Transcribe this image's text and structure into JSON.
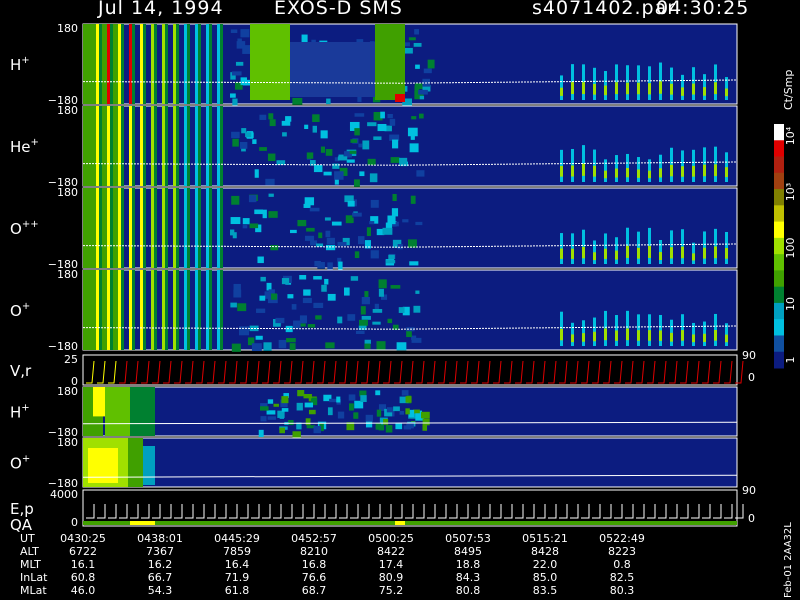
{
  "header": {
    "date": "Jul 14, 1994",
    "instrument": "EXOS-D SMS",
    "file": "s4071402.par",
    "time": "04:30:25"
  },
  "colorbar": {
    "unit": "Ct/Smp",
    "ticks": [
      "10⁴",
      "10³",
      "100",
      "10",
      "1"
    ],
    "colors": [
      "#ffffff",
      "#e00000",
      "#b02010",
      "#a04010",
      "#808000",
      "#c0c000",
      "#ffff00",
      "#a0e000",
      "#60c000",
      "#40a000",
      "#008030",
      "#00a0c0",
      "#00c0e0",
      "#1050a0",
      "#0c1c80"
    ]
  },
  "chart_data": {
    "type": "heatmap",
    "x_time_ticks": [
      "0430:25",
      "0438:01",
      "0445:29",
      "0452:57",
      "0500:25",
      "0507:53",
      "0515:21",
      "0522:49"
    ],
    "panels": [
      {
        "label": "H",
        "sup": "+",
        "y_top": "180",
        "y_bottom": "−180"
      },
      {
        "label": "He",
        "sup": "+",
        "y_top": "180",
        "y_bottom": "−180"
      },
      {
        "label": "O",
        "sup": "++",
        "y_top": "180",
        "y_bottom": "−180"
      },
      {
        "label": "O",
        "sup": "+",
        "y_top": "180",
        "y_bottom": "−180"
      },
      {
        "label": "V,r",
        "sup": "",
        "y_top": "25",
        "y_bottom": "0",
        "right_top": "90",
        "right_bottom": "0"
      },
      {
        "label": "H",
        "sup": "+",
        "y_top": "180",
        "y_bottom": "−180"
      },
      {
        "label": "O",
        "sup": "+",
        "y_top": "180",
        "y_bottom": "−180"
      },
      {
        "label": "E,p",
        "label2": "QA",
        "sup": "",
        "y_top": "4000",
        "y_bottom": "0",
        "right_top": "90",
        "right_bottom": "0"
      }
    ],
    "table": {
      "rows": [
        {
          "name": "UT",
          "values": [
            "0430:25",
            "0438:01",
            "0445:29",
            "0452:57",
            "0500:25",
            "0507:53",
            "0515:21",
            "0522:49"
          ]
        },
        {
          "name": "ALT",
          "values": [
            "6722",
            "7367",
            "7859",
            "8210",
            "8422",
            "8495",
            "8428",
            "8223"
          ]
        },
        {
          "name": "MLT",
          "values": [
            "16.1",
            "16.2",
            "16.4",
            "16.8",
            "17.4",
            "18.8",
            "22.0",
            "0.8"
          ]
        },
        {
          "name": "InLat",
          "values": [
            "60.8",
            "66.7",
            "71.9",
            "76.6",
            "80.9",
            "84.3",
            "85.0",
            "82.5"
          ]
        },
        {
          "name": "MLat",
          "values": [
            "46.0",
            "54.3",
            "61.8",
            "68.7",
            "75.2",
            "80.8",
            "83.5",
            "80.3"
          ]
        }
      ]
    }
  },
  "footer_id": "Feb-01 2AA32L"
}
